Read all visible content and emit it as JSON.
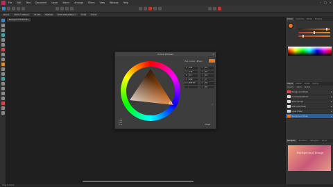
{
  "menubar": {
    "items": [
      "File",
      "Edit",
      "Text",
      "Document",
      "Layer",
      "Select",
      "Arrange",
      "Filters",
      "View",
      "Window",
      "Help"
    ]
  },
  "context": {
    "chips": [
      "Pixels",
      "1920 x 1080 px",
      "72 DPI",
      "RGBA/8",
      "sRGB IEC61966-2.1",
      "Units",
      "Pixels"
    ]
  },
  "document": {
    "tab_label": "Background.afphoto"
  },
  "dialog": {
    "title": "Colour Chooser",
    "hex_label": "Hex Colour (#hex)",
    "hex_swatch": "#e8771f",
    "fields": [
      {
        "l": "R",
        "v": "232",
        "l2": "H",
        "v2": "25"
      },
      {
        "l": "G",
        "v": "119",
        "l2": "S",
        "v2": "81"
      },
      {
        "l": "B",
        "v": "31",
        "l2": "L",
        "v2": "52"
      },
      {
        "l": "A",
        "v": "100",
        "l2": "C",
        "v2": "0"
      },
      {
        "l": "Hex",
        "v": "E8771F",
        "l2": "M",
        "v2": "49"
      },
      {
        "l": "",
        "v": "",
        "l2": "Y",
        "v2": "87"
      }
    ],
    "small_labels": [
      "1.00",
      "0.47",
      "0.12"
    ],
    "close_label": "Close"
  },
  "panel": {
    "tabs": [
      "Colour",
      "Swatches",
      "Stroke",
      "Brushes"
    ],
    "layer_tabs": [
      "Layers",
      "Effects",
      "Styles",
      "History"
    ],
    "opacity_label": "Opacity:",
    "opacity_value": "100 %",
    "blend": "Normal",
    "layers": [
      {
        "name": "Background (Pixel)",
        "thumb": "red"
      },
      {
        "name": "Curves Adjustment",
        "thumb": "white"
      },
      {
        "name": "Glow (Group)",
        "thumb": "white"
      },
      {
        "name": "Soft Light (Pixel)",
        "thumb": "white"
      },
      {
        "name": "Layer (Pixel)",
        "thumb": "white"
      },
      {
        "name": "Background (Pixel)",
        "thumb": "orange",
        "selected": true
      }
    ],
    "nav_tabs": [
      "Navigator",
      "Transform",
      "Histogram",
      "32-bit"
    ],
    "preview_text": "Background Image"
  },
  "status": {
    "text": "Drag to move"
  },
  "colors": {
    "accent": "#3a86c8",
    "selected_color": "#e8771f"
  }
}
